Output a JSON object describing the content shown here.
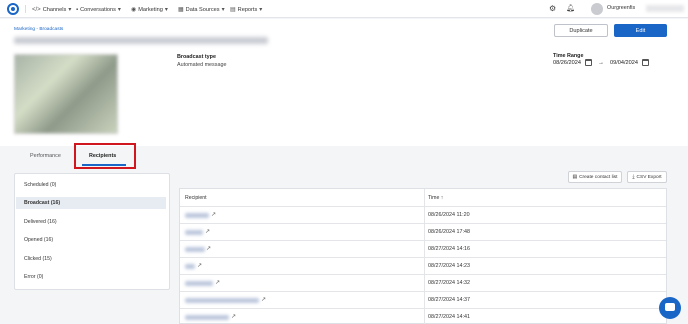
{
  "nav": {
    "items": [
      {
        "label": "Channels",
        "icon": "code-icon"
      },
      {
        "label": "Conversations",
        "icon": "chat-icon"
      },
      {
        "label": "Marketing",
        "icon": "wifi-icon"
      },
      {
        "label": "Data Sources",
        "icon": "data-icon"
      },
      {
        "label": "Reports",
        "icon": "chart-icon"
      }
    ],
    "username": "Ourgreenfis"
  },
  "header": {
    "breadcrumb": "Marketing - Broadcasts",
    "broadcast_type_label": "Broadcast type",
    "broadcast_type_value": "Automated message",
    "duplicate_label": "Duplicate",
    "edit_label": "Edit",
    "time_range_label": "Time Range",
    "date_from": "08/26/2024",
    "date_to": "09/04/2024"
  },
  "tabs": [
    {
      "label": "Performance"
    },
    {
      "label": "Recipients"
    }
  ],
  "sidebar": {
    "items": [
      {
        "label": "Scheduled",
        "count": "(0)"
      },
      {
        "label": "Broadcast",
        "count": "(16)"
      },
      {
        "label": "Delivered",
        "count": "(16)"
      },
      {
        "label": "Opened",
        "count": "(16)"
      },
      {
        "label": "Clicked",
        "count": "(15)"
      },
      {
        "label": "Error",
        "count": "(0)"
      }
    ]
  },
  "actions": {
    "create_contact_list": "Create contact list",
    "csv_export": "CSV Export"
  },
  "table": {
    "headers": {
      "recipient": "Recipient",
      "time": "Time ↑"
    },
    "rows": [
      {
        "time": "08/26/2024 11:20"
      },
      {
        "time": "08/26/2024 17:48"
      },
      {
        "time": "08/27/2024 14:16"
      },
      {
        "time": "08/27/2024 14:23"
      },
      {
        "time": "08/27/2024 14:32"
      },
      {
        "time": "08/27/2024 14:37"
      },
      {
        "time": "08/27/2024 14:41"
      }
    ]
  },
  "colors": {
    "accent": "#1a66c6",
    "highlight": "#d0161f"
  }
}
